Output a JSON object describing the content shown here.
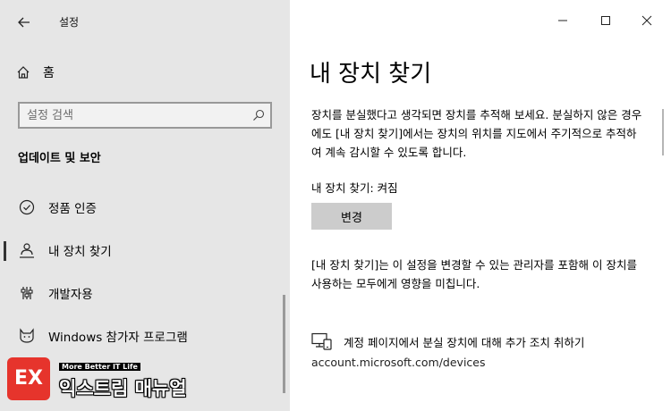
{
  "app": {
    "title": "설정"
  },
  "sidebar": {
    "home_label": "홈",
    "search_placeholder": "설정 검색",
    "section_title": "업데이트 및 보안",
    "items": [
      {
        "label": "정품 인증",
        "icon": "check-circle-icon"
      },
      {
        "label": "내 장치 찾기",
        "icon": "person-location-icon",
        "active": true
      },
      {
        "label": "개발자용",
        "icon": "developer-tools-icon"
      },
      {
        "label": "Windows 참가자 프로그램",
        "icon": "cat-icon"
      }
    ]
  },
  "main": {
    "title": "내 장치 찾기",
    "description": "장치를 분실했다고 생각되면 장치를 추적해 보세요. 분실하지 않은 경우에도 [내 장치 찾기]에서는 장치의 위치를 지도에서 주기적으로 추적하여 계속 감시할 수 있도록 합니다.",
    "status_text": "내 장치 찾기: 켜짐",
    "change_button": "변경",
    "note": "[내 장치 찾기]는 이 설정을 변경할 수 있는 관리자를 포함해 이 장치를 사용하는 모두에게 영향을 미칩니다.",
    "account_link": "계정 페이지에서 분실 장치에 대해 추가 조치 취하기",
    "url": "account.microsoft.com/devices"
  },
  "watermark": {
    "logo_text": "EX",
    "tagline": "More Better IT Life",
    "brand": "익스트림 매뉴얼"
  },
  "colors": {
    "sidebar_bg": "#e6e6e6",
    "main_bg": "#ffffff",
    "button_bg": "#cccccc",
    "logo_red": "#e6342c"
  }
}
